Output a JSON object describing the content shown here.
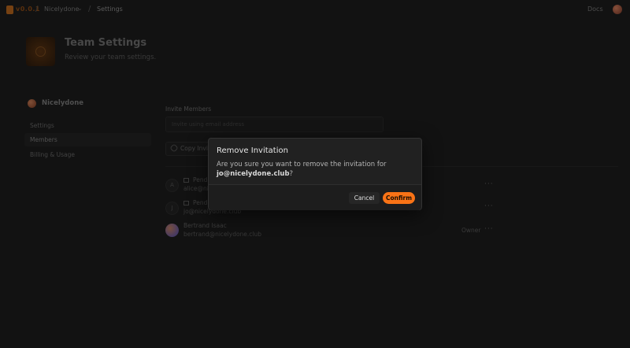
{
  "topbar": {
    "brand": "v0.0.1",
    "team_name": "Nicelydone",
    "crumb": "Settings",
    "docs": "Docs"
  },
  "header": {
    "title": "Team Settings",
    "subtitle": "Review your team settings."
  },
  "sidebar": {
    "team": "Nicelydone",
    "items": [
      {
        "label": "Settings"
      },
      {
        "label": "Members"
      },
      {
        "label": "Billing & Usage"
      }
    ],
    "active": "Members"
  },
  "invite": {
    "label": "Invite Members",
    "placeholder": "Invite using email address",
    "copy_label": "Copy Invit"
  },
  "members": [
    {
      "initial": "A",
      "name": "Pendi",
      "email": "alice@nic",
      "role": ""
    },
    {
      "initial": "J",
      "name": "Pendi",
      "email": "jo@nicelydone.club",
      "role": ""
    },
    {
      "initial": "",
      "name": "Bertrand Isaac",
      "email": "bertrand@nicelydone.club",
      "role": "Owner"
    }
  ],
  "modal": {
    "title": "Remove Invitation",
    "body_prefix": "Are you sure you want to remove the invitation for",
    "email": "jo@nicelydone.club",
    "body_suffix": "?",
    "cancel": "Cancel",
    "confirm": "Confirm"
  },
  "colors": {
    "accent": "#f97316",
    "background": "#1c1c1c",
    "modal": "#212121"
  },
  "icons": [
    "logo-icon",
    "chevron-down-icon",
    "avatar-icon",
    "link-icon",
    "mail-icon",
    "more-icon"
  ]
}
